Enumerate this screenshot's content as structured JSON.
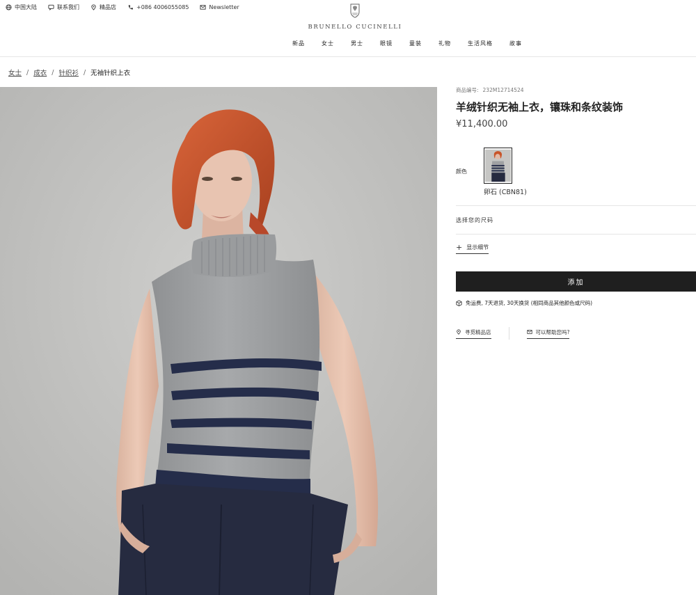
{
  "utility_bar": {
    "region": "中国大陆",
    "contact": "联系我们",
    "stores": "精品店",
    "phone": "+086 4006055085",
    "newsletter": "Newsletter"
  },
  "brand": {
    "name": "BRUNELLO CUCINELLI"
  },
  "nav": {
    "items": [
      "新品",
      "女士",
      "男士",
      "眼镜",
      "童装",
      "礼物",
      "生活风格",
      "故事"
    ]
  },
  "breadcrumb": {
    "items": [
      "女士",
      "成衣",
      "针织衫"
    ],
    "current": "无袖针织上衣"
  },
  "product": {
    "sku_label": "商品编号:",
    "sku": "232M12714524",
    "title": "羊绒针织无袖上衣，镶珠和条纹装饰",
    "price": "¥11,400.00",
    "color_label": "颜色",
    "color_name": "卵石 (CBN81)",
    "size_label": "选择您的尺码",
    "details_label": "显示细节",
    "add_button": "添加",
    "shipping_text": "免运费, 7天退货, 30天换货 (相同商品其他颜色或尺码)",
    "store_link": "寻觅精品店",
    "help_link": "可以帮助您吗?"
  },
  "colors": {
    "accent_dark": "#1f1f1f",
    "sweater_grey": "#9fa1a3",
    "stripe_navy": "#252d4a",
    "hair": "#c8552a",
    "backdrop": "#c4c4c2"
  }
}
